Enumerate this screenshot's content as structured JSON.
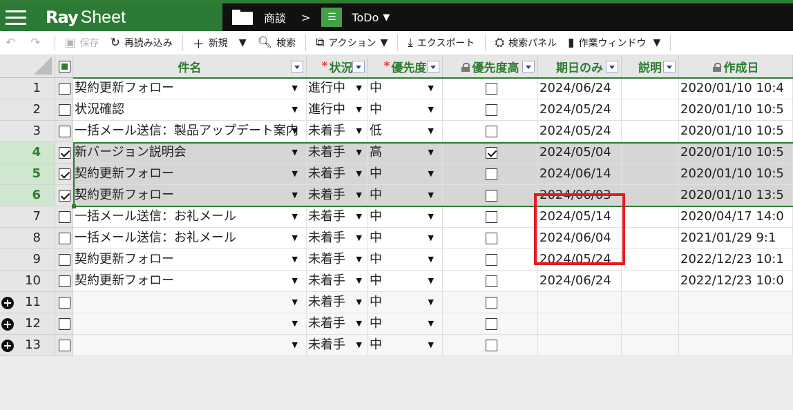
{
  "header": {
    "logo_ray": "Ray",
    "logo_sheet": "Sheet",
    "breadcrumb_folder": "商談",
    "breadcrumb_sep": ">",
    "breadcrumb_sheet": "ToDo",
    "caret": "▼",
    "brand_color": "#2d7a36"
  },
  "toolbar": {
    "undo_icon": "↶",
    "redo_icon": "↷",
    "save_label": "保存",
    "reload_label": "再読み込み",
    "new_label": "新規",
    "search_label": "検索",
    "action_label": "アクション",
    "export_label": "エクスポート",
    "search_panel_label": "検索パネル",
    "work_window_label": "作業ウィンドウ",
    "caret": "▼"
  },
  "columns": [
    {
      "key": "subject",
      "label": "件名",
      "required": false,
      "locked": false,
      "filter": true
    },
    {
      "key": "status",
      "label": "状況",
      "required": true,
      "locked": false,
      "filter": true
    },
    {
      "key": "priority",
      "label": "優先度",
      "required": true,
      "locked": false,
      "filter": true
    },
    {
      "key": "high",
      "label": "優先度高",
      "required": false,
      "locked": true,
      "filter": true
    },
    {
      "key": "due",
      "label": "期日のみ",
      "required": false,
      "locked": false,
      "filter": true
    },
    {
      "key": "desc",
      "label": "説明",
      "required": false,
      "locked": false,
      "filter": true
    },
    {
      "key": "created",
      "label": "作成日",
      "required": false,
      "locked": true,
      "filter": false
    }
  ],
  "required_mark": "*",
  "rows": [
    {
      "num": "1",
      "checked": false,
      "selected": false,
      "subject": "契約更新フォロー",
      "status": "進行中",
      "priority": "中",
      "high": false,
      "due": "2024/06/24",
      "desc": "",
      "created": "2020/01/10 10:4"
    },
    {
      "num": "2",
      "checked": false,
      "selected": false,
      "subject": "状況確認",
      "status": "進行中",
      "priority": "中",
      "high": false,
      "due": "2024/05/24",
      "desc": "",
      "created": "2020/01/10 10:5"
    },
    {
      "num": "3",
      "checked": false,
      "selected": false,
      "subject": "一括メール送信：製品アップデート案内",
      "status": "未着手",
      "priority": "低",
      "high": false,
      "due": "2024/05/24",
      "desc": "",
      "created": "2020/01/10 10:5"
    },
    {
      "num": "4",
      "checked": true,
      "selected": true,
      "subject": "新バージョン説明会",
      "status": "未着手",
      "priority": "高",
      "high": true,
      "due": "2024/05/04",
      "desc": "",
      "created": "2020/01/10 10:5"
    },
    {
      "num": "5",
      "checked": true,
      "selected": true,
      "subject": "契約更新フォロー",
      "status": "未着手",
      "priority": "中",
      "high": false,
      "due": "2024/06/14",
      "desc": "",
      "created": "2020/01/10 10:5"
    },
    {
      "num": "6",
      "checked": true,
      "selected": true,
      "subject": "契約更新フォロー",
      "status": "未着手",
      "priority": "中",
      "high": false,
      "due": "2024/06/03",
      "desc": "",
      "created": "2020/01/10 13:5"
    },
    {
      "num": "7",
      "checked": false,
      "selected": false,
      "subject": "一括メール送信：お礼メール",
      "status": "未着手",
      "priority": "中",
      "high": false,
      "due": "2024/05/14",
      "desc": "",
      "created": "2020/04/17 14:0"
    },
    {
      "num": "8",
      "checked": false,
      "selected": false,
      "subject": "一括メール送信：お礼メール",
      "status": "未着手",
      "priority": "中",
      "high": false,
      "due": "2024/06/04",
      "desc": "",
      "created": "2021/01/29 9:1"
    },
    {
      "num": "9",
      "checked": false,
      "selected": false,
      "subject": "契約更新フォロー",
      "status": "未着手",
      "priority": "中",
      "high": false,
      "due": "2024/05/24",
      "desc": "",
      "created": "2022/12/23 10:1"
    },
    {
      "num": "10",
      "checked": false,
      "selected": false,
      "subject": "契約更新フォロー",
      "status": "未着手",
      "priority": "中",
      "high": false,
      "due": "2024/06/24",
      "desc": "",
      "created": "2022/12/23 10:0"
    },
    {
      "num": "11",
      "checked": false,
      "selected": false,
      "empty": true,
      "subject": "",
      "status": "未着手",
      "priority": "中",
      "high": false,
      "due": "",
      "desc": "",
      "created": ""
    },
    {
      "num": "12",
      "checked": false,
      "selected": false,
      "empty": true,
      "subject": "",
      "status": "未着手",
      "priority": "中",
      "high": false,
      "due": "",
      "desc": "",
      "created": ""
    },
    {
      "num": "13",
      "checked": false,
      "selected": false,
      "empty": true,
      "subject": "",
      "status": "未着手",
      "priority": "中",
      "high": false,
      "due": "",
      "desc": "",
      "created": ""
    }
  ],
  "dropdown_glyph": "▼",
  "highlight_color": "#e31b23"
}
